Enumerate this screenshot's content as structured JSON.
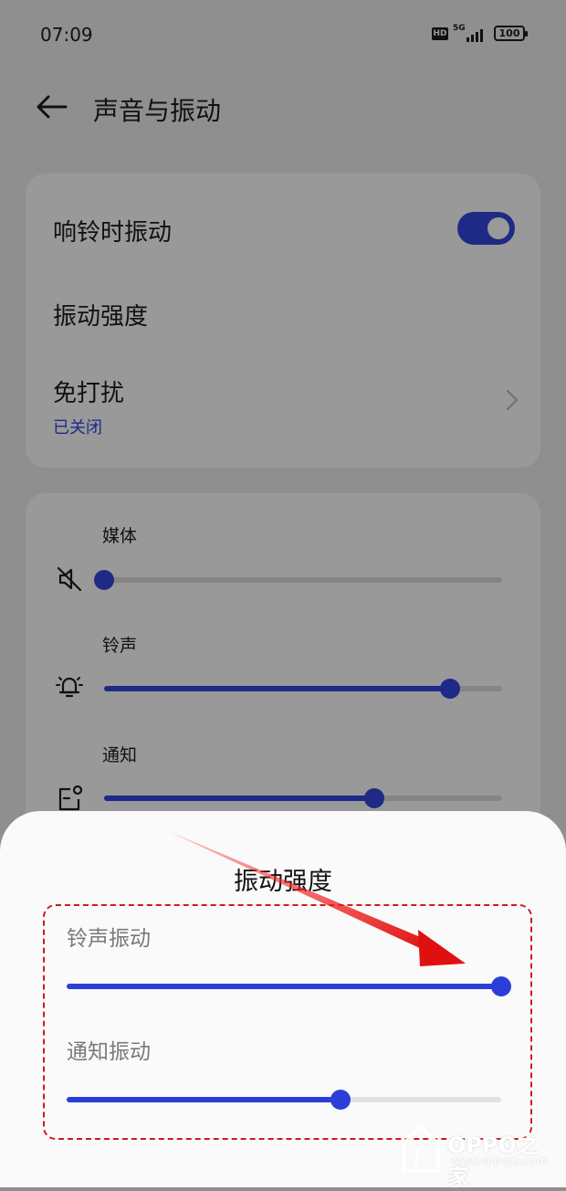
{
  "status_bar": {
    "time": "07:09",
    "hd": "HD",
    "network": "5G",
    "battery": "100"
  },
  "header": {
    "title": "声音与振动"
  },
  "card1": {
    "ring_vibrate_label": "响铃时振动",
    "ring_vibrate_on": true,
    "vibration_strength_label": "振动强度",
    "dnd_label": "免打扰",
    "dnd_status": "已关闭"
  },
  "volume": {
    "media": {
      "label": "媒体",
      "value": 0.0
    },
    "ringtone": {
      "label": "铃声",
      "value": 0.87
    },
    "notification": {
      "label": "通知",
      "value": 0.68
    }
  },
  "sheet": {
    "title": "振动强度",
    "ring_vibration": {
      "label": "铃声振动",
      "value": 1.0
    },
    "notification_vibration": {
      "label": "通知振动",
      "value": 0.63
    }
  },
  "watermark": {
    "brand": "OPPO之家",
    "url": "www.oppojia.com"
  },
  "colors": {
    "accent": "#1f2a86",
    "sheet_accent": "#2a3fd8",
    "annotation": "#d11a1a"
  }
}
